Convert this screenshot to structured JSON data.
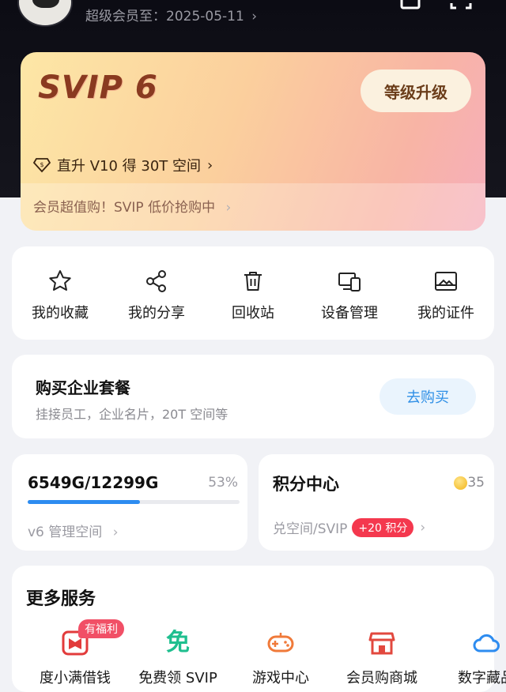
{
  "header": {
    "expiry_text": "超级会员至：2025-05-11",
    "chevron": "›"
  },
  "member_card": {
    "level_logo": "SVIP 6",
    "upgrade_label": "等级升级",
    "promo_upgrade": "直升 V10 得 30T 空间",
    "promo_sale": "会员超值购！SVIP 低价抢购中",
    "chevron": "›"
  },
  "quick_actions": [
    {
      "label": "我的收藏",
      "icon": "star-icon"
    },
    {
      "label": "我的分享",
      "icon": "share-icon"
    },
    {
      "label": "回收站",
      "icon": "trash-icon"
    },
    {
      "label": "设备管理",
      "icon": "devices-icon"
    },
    {
      "label": "我的证件",
      "icon": "id-card-icon"
    }
  ],
  "business": {
    "title": "购买企业套餐",
    "subtitle": "挂接员工，企业名片，20T 空间等",
    "button": "去购买"
  },
  "storage": {
    "used_total": "6549G/12299G",
    "percent_text": "53%",
    "progress": 0.53,
    "link": "v6 管理空间",
    "chevron": "›"
  },
  "points": {
    "title": "积分中心",
    "count": "35",
    "link": "兑空间/SVIP",
    "badge": "+20 积分",
    "chevron": "›"
  },
  "more_services": {
    "title": "更多服务",
    "items": [
      {
        "label": "度小满借钱",
        "tag": "有福利",
        "icon": "wallet-icon"
      },
      {
        "label": "免费领 SVIP",
        "icon": "free-icon",
        "glyph": "免"
      },
      {
        "label": "游戏中心",
        "icon": "gamepad-icon"
      },
      {
        "label": "会员购商城",
        "icon": "store-icon"
      },
      {
        "label": "数字藏品",
        "icon": "cloud-icon"
      }
    ]
  },
  "colors": {
    "accent_blue": "#2d8cf0",
    "badge_red": "#f4384e",
    "card_gold": "#fde7a6",
    "card_pink": "#f6aebb"
  }
}
